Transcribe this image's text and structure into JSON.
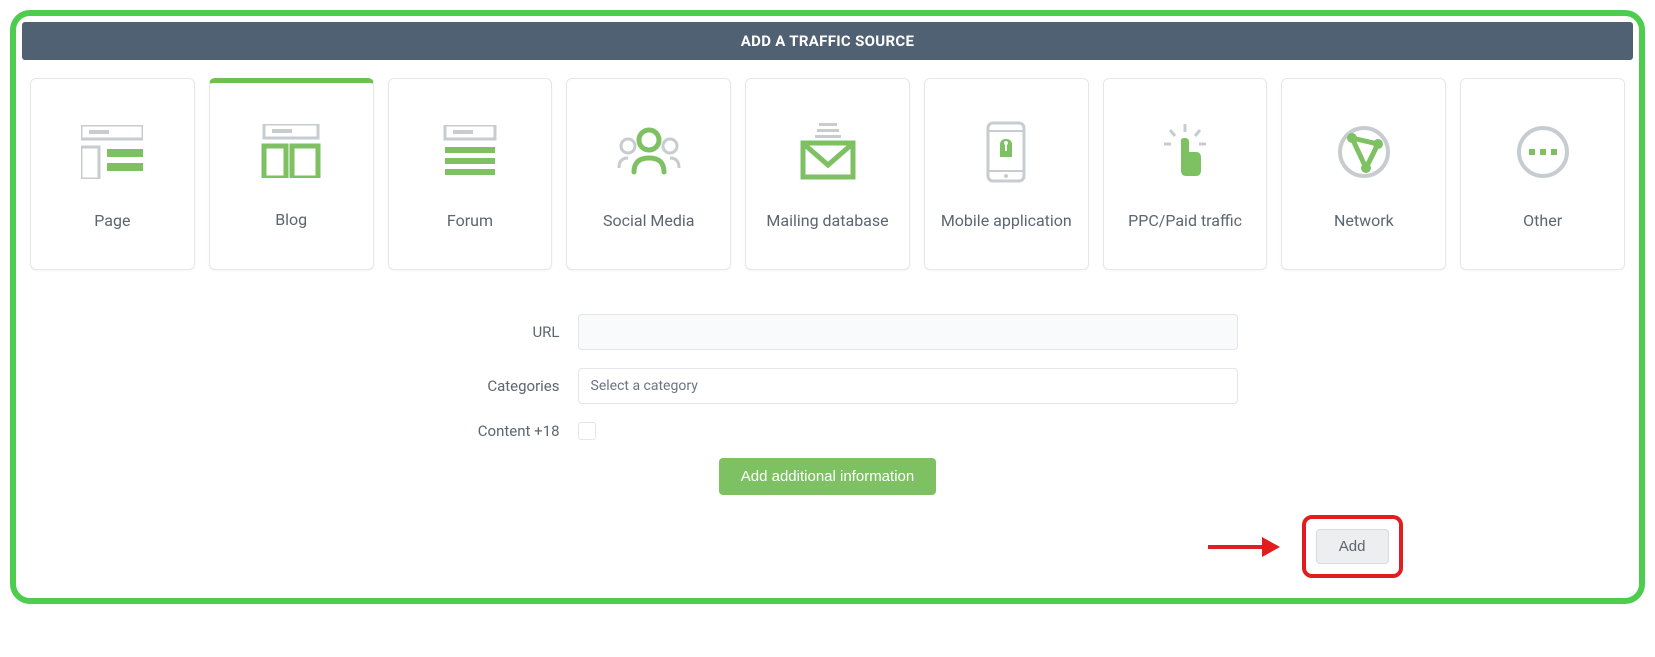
{
  "header": {
    "title": "ADD A TRAFFIC SOURCE"
  },
  "cards": {
    "page": "Page",
    "blog": "Blog",
    "forum": "Forum",
    "social": "Social Media",
    "mailing": "Mailing database",
    "mobile": "Mobile application",
    "ppc": "PPC/Paid traffic",
    "network": "Network",
    "other": "Other"
  },
  "form": {
    "url_label": "URL",
    "categories_label": "Categories",
    "categories_placeholder": "Select a category",
    "content18_label": "Content +18",
    "additional_button": "Add additional information",
    "add_button": "Add"
  }
}
